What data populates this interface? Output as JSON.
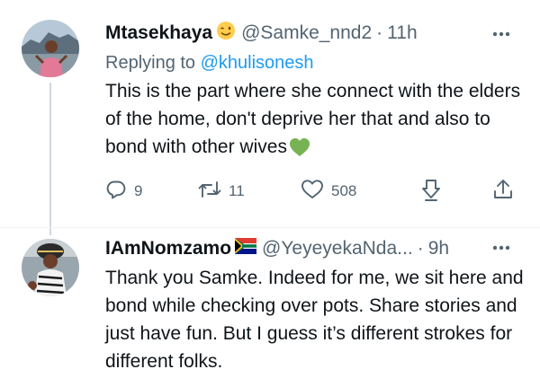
{
  "tweets": [
    {
      "display_name": "Mtasekhaya",
      "name_emoji": "winking-face-emoji",
      "handle": "@Samke_nnd2",
      "separator": "·",
      "time": "11h",
      "replying_prefix": "Replying to",
      "replying_to": "@khulisonesh",
      "text": "This is the part where she connect with the elders of the home, don't deprive her that and also to bond with other wives",
      "text_emoji": "green-heart-emoji",
      "actions": {
        "reply_count": "9",
        "retweet_count": "11",
        "like_count": "508"
      }
    },
    {
      "display_name": "IAmNomzamo",
      "name_emoji": "south-africa-flag-emoji",
      "handle": "@YeyeyekaNda...",
      "separator": "·",
      "time": "9h",
      "text": "Thank you Samke. Indeed for me, we sit here and bond while checking over pots. Share stories and just have fun. But I guess it’s different strokes for different folks."
    }
  ],
  "colors": {
    "text_primary": "#0f1419",
    "text_secondary": "#536471",
    "link": "#1d9bf0",
    "thread_line": "#cfd9de",
    "divider": "#eff3f4"
  },
  "icons": [
    "more-icon",
    "reply-icon",
    "retweet-icon",
    "like-icon",
    "share-icon",
    "upload-icon"
  ]
}
